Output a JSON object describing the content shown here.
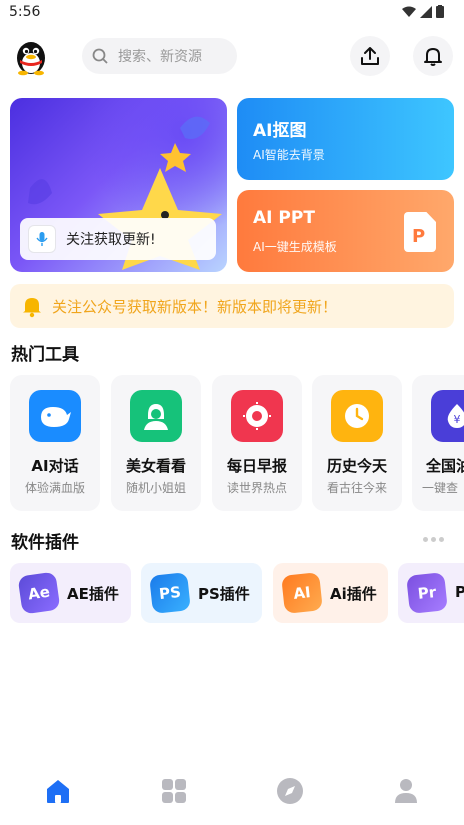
{
  "status": {
    "time": "5:56"
  },
  "header": {
    "search_placeholder": "搜索、新资源"
  },
  "banner": {
    "toast_text": "关注获取更新!"
  },
  "cards": [
    {
      "title": "AI抠图",
      "subtitle": "AI智能去背景"
    },
    {
      "title": "AI PPT",
      "subtitle": "AI一键生成模板",
      "badge": "P"
    }
  ],
  "notice": {
    "text": "关注公众号获取新版本！新版本即将更新！"
  },
  "tools_section": {
    "title": "热门工具"
  },
  "tools": [
    {
      "name": "AI对话",
      "desc": "体验满血版"
    },
    {
      "name": "美女看看",
      "desc": "随机小姐姐"
    },
    {
      "name": "每日早报",
      "desc": "读世界热点"
    },
    {
      "name": "历史今天",
      "desc": "看古往今来"
    },
    {
      "name": "全国油",
      "desc": "一键查",
      "badge": "¥"
    }
  ],
  "plugins_section": {
    "title": "软件插件"
  },
  "plugins": [
    {
      "label": "AE插件",
      "icon_text": "Ae"
    },
    {
      "label": "PS插件",
      "icon_text": "PS"
    },
    {
      "label": "Ai插件",
      "icon_text": "AI"
    },
    {
      "label": "P",
      "icon_text": "Pr"
    }
  ],
  "colors": {
    "accent": "#1e6ff5",
    "notice": "#f0a51c"
  }
}
